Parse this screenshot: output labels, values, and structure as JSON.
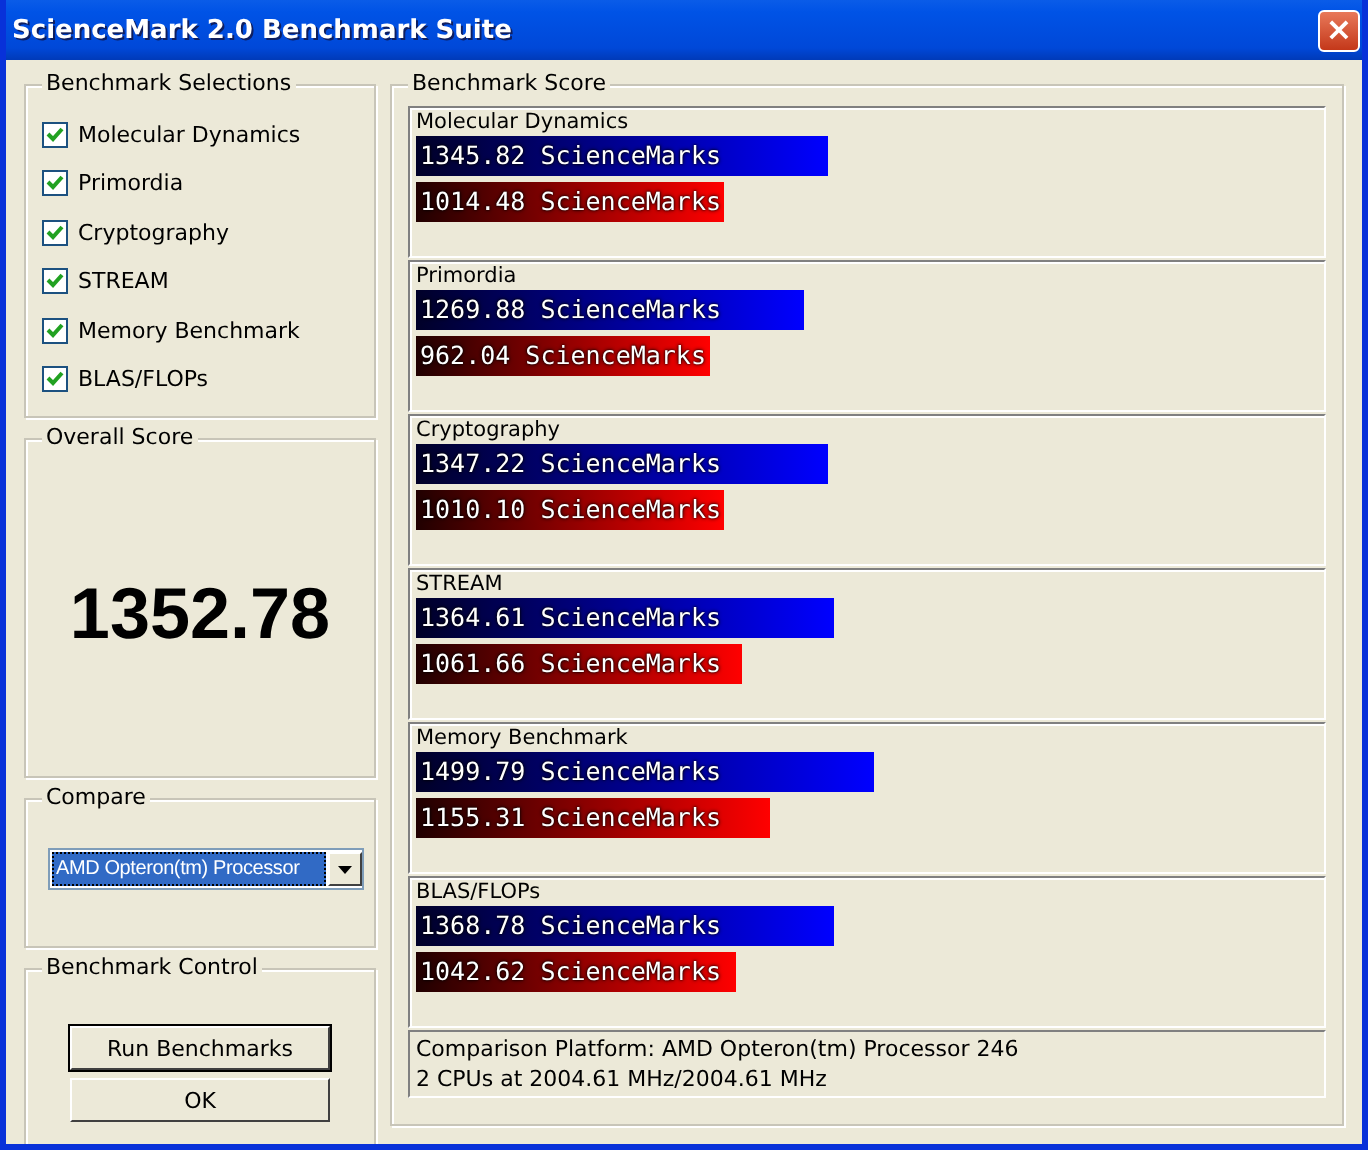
{
  "window": {
    "title": "ScienceMark 2.0 Benchmark Suite",
    "close": "×"
  },
  "selections": {
    "title": "Benchmark Selections",
    "items": [
      {
        "label": "Molecular Dynamics",
        "checked": true
      },
      {
        "label": "Primordia",
        "checked": true
      },
      {
        "label": "Cryptography",
        "checked": true
      },
      {
        "label": "STREAM",
        "checked": true
      },
      {
        "label": "Memory Benchmark",
        "checked": true
      },
      {
        "label": "BLAS/FLOPs",
        "checked": true
      }
    ]
  },
  "overall": {
    "title": "Overall Score",
    "value": "1352.78"
  },
  "compare": {
    "title": "Compare",
    "value": "AMD Opteron(tm) Processor"
  },
  "control": {
    "title": "Benchmark Control",
    "buttons": [
      "Run Benchmarks",
      "OK"
    ]
  },
  "scores": {
    "title": "Benchmark Score",
    "groups": [
      {
        "name": "Molecular Dynamics",
        "yours": {
          "text": "1345.82 ScienceMarks",
          "level": 0.46
        },
        "compare": {
          "text": "1014.48 ScienceMarks",
          "level": 0.344
        }
      },
      {
        "name": "Primordia",
        "yours": {
          "text": "1269.88 ScienceMarks",
          "level": 0.433
        },
        "compare": {
          "text": "962.04 ScienceMarks",
          "level": 0.328
        }
      },
      {
        "name": "Cryptography",
        "yours": {
          "text": "1347.22 ScienceMarks",
          "level": 0.46
        },
        "compare": {
          "text": "1010.10 ScienceMarks",
          "level": 0.344
        }
      },
      {
        "name": "STREAM",
        "yours": {
          "text": "1364.61 ScienceMarks",
          "level": 0.467
        },
        "compare": {
          "text": "1061.66 ScienceMarks",
          "level": 0.364
        }
      },
      {
        "name": "Memory Benchmark",
        "yours": {
          "text": "1499.79 ScienceMarks",
          "level": 0.511
        },
        "compare": {
          "text": "1155.31 ScienceMarks",
          "level": 0.395
        }
      },
      {
        "name": "BLAS/FLOPs",
        "yours": {
          "text": "1368.78 ScienceMarks",
          "level": 0.467
        },
        "compare": {
          "text": "1042.62 ScienceMarks",
          "level": 0.357
        }
      }
    ],
    "platform": [
      "Comparison Platform: AMD Opteron(tm) Processor 246",
      "2 CPUs at 2004.61 MHz/2004.61 MHz"
    ]
  }
}
